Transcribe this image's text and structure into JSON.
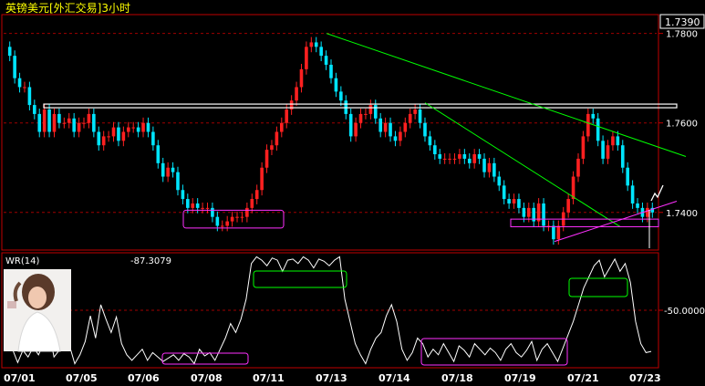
{
  "title": "英镑美元[外汇交易]3小时",
  "colors": {
    "background": "#000000",
    "frame": "#c00000",
    "grid": "#a00000",
    "up_candle": "#ff2020",
    "down_candle": "#00e5ff",
    "indicator_line": "#ffffff",
    "trend_down": "#00ff00",
    "trend_up": "#ff30ff",
    "resistance": "#ffffff",
    "box_low": "#ff30ff",
    "box_high": "#00ff00",
    "axis_text": "#ffffff",
    "title_text": "#ffff00"
  },
  "indicator": {
    "label": "WR(14)",
    "value": "-87.3079"
  },
  "icons": {
    "thumbnail": "portrait-photo-icon"
  },
  "chart_data": [
    {
      "type": "candlestick",
      "title": "英镑美元[外汇交易]3小时",
      "ylim": [
        1.732,
        1.7838
      ],
      "y_tick_labels": [
        "1.7800",
        "1.7600",
        "1.7400"
      ],
      "current_price_label": "1.7390",
      "x_tick_labels": [
        "07/01",
        "07/05",
        "07/06",
        "07/08",
        "07/11",
        "07/13",
        "07/14",
        "07/18",
        "07/19",
        "07/21",
        "07/23"
      ],
      "grid": true,
      "annotations": [
        {
          "kind": "horizontal_line",
          "y": 1.7638
        },
        {
          "kind": "trend_line",
          "from": [
            0,
            1.78
          ],
          "to": [
            1,
            1.7525
          ]
        },
        {
          "kind": "trend_line",
          "from": [
            0,
            1.7335
          ],
          "to": [
            1,
            1.7425
          ]
        },
        {
          "kind": "box",
          "y_range": [
            1.7365,
            1.7405
          ]
        },
        {
          "kind": "box",
          "y_range": [
            1.7368,
            1.7385
          ]
        }
      ],
      "ohlc_close": [
        1.775,
        1.77,
        1.768,
        1.768,
        1.764,
        1.762,
        1.758,
        1.763,
        1.758,
        1.762,
        1.76,
        1.76,
        1.761,
        1.758,
        1.76,
        1.76,
        1.762,
        1.758,
        1.755,
        1.757,
        1.757,
        1.759,
        1.756,
        1.758,
        1.759,
        1.759,
        1.758,
        1.76,
        1.758,
        1.755,
        1.751,
        1.748,
        1.75,
        1.749,
        1.745,
        1.743,
        1.741,
        1.742,
        1.741,
        1.741,
        1.741,
        1.739,
        1.737,
        1.737,
        1.738,
        1.739,
        1.739,
        1.739,
        1.741,
        1.743,
        1.745,
        1.75,
        1.754,
        1.755,
        1.758,
        1.76,
        1.763,
        1.765,
        1.768,
        1.772,
        1.777,
        1.778,
        1.777,
        1.775,
        1.773,
        1.77,
        1.767,
        1.765,
        1.762,
        1.757,
        1.76,
        1.762,
        1.762,
        1.764,
        1.761,
        1.758,
        1.76,
        1.757,
        1.756,
        1.758,
        1.76,
        1.762,
        1.763,
        1.76,
        1.757,
        1.755,
        1.753,
        1.752,
        1.752,
        1.752,
        1.752,
        1.753,
        1.752,
        1.751,
        1.753,
        1.752,
        1.749,
        1.751,
        1.748,
        1.746,
        1.743,
        1.742,
        1.743,
        1.741,
        1.739,
        1.741,
        1.738,
        1.742,
        1.737,
        1.737,
        1.734,
        1.737,
        1.74,
        1.743,
        1.748,
        1.752,
        1.757,
        1.762,
        1.761,
        1.756,
        1.752,
        1.755,
        1.757,
        1.755,
        1.75,
        1.746,
        1.742,
        1.741,
        1.739,
        1.741,
        1.74
      ]
    },
    {
      "type": "line",
      "title": "WR(14)",
      "current_value": -87.3079,
      "ylim": [
        -100,
        0
      ],
      "y_tick_labels": [
        "-50.0000"
      ],
      "grid": true,
      "annotations": [
        {
          "kind": "box",
          "region": "oversold"
        },
        {
          "kind": "box",
          "region": "overbought"
        },
        {
          "kind": "box",
          "region": "oversold"
        },
        {
          "kind": "box",
          "region": "overbought"
        }
      ],
      "values": [
        -75,
        -85,
        -97,
        -86,
        -92,
        -83,
        -90,
        -80,
        -68,
        -92,
        -86,
        -75,
        -82,
        -98,
        -90,
        -78,
        -55,
        -75,
        -45,
        -58,
        -70,
        -56,
        -80,
        -90,
        -95,
        -90,
        -85,
        -95,
        -88,
        -92,
        -96,
        -93,
        -90,
        -95,
        -89,
        -92,
        -98,
        -85,
        -91,
        -88,
        -95,
        -85,
        -75,
        -62,
        -70,
        -58,
        -40,
        -8,
        -2,
        -5,
        -10,
        -3,
        -5,
        -15,
        -5,
        -4,
        -8,
        -2,
        -5,
        -12,
        -4,
        -6,
        -10,
        -5,
        -2,
        -40,
        -60,
        -80,
        -90,
        -98,
        -85,
        -75,
        -70,
        -55,
        -45,
        -60,
        -85,
        -95,
        -88,
        -75,
        -80,
        -92,
        -85,
        -90,
        -80,
        -88,
        -96,
        -82,
        -86,
        -92,
        -80,
        -85,
        -90,
        -84,
        -88,
        -95,
        -85,
        -80,
        -88,
        -92,
        -86,
        -78,
        -95,
        -85,
        -80,
        -88,
        -96,
        -84,
        -72,
        -60,
        -45,
        -30,
        -20,
        -10,
        -5,
        -20,
        -12,
        -4,
        -15,
        -8,
        -25,
        -60,
        -80,
        -88,
        -87
      ]
    }
  ]
}
